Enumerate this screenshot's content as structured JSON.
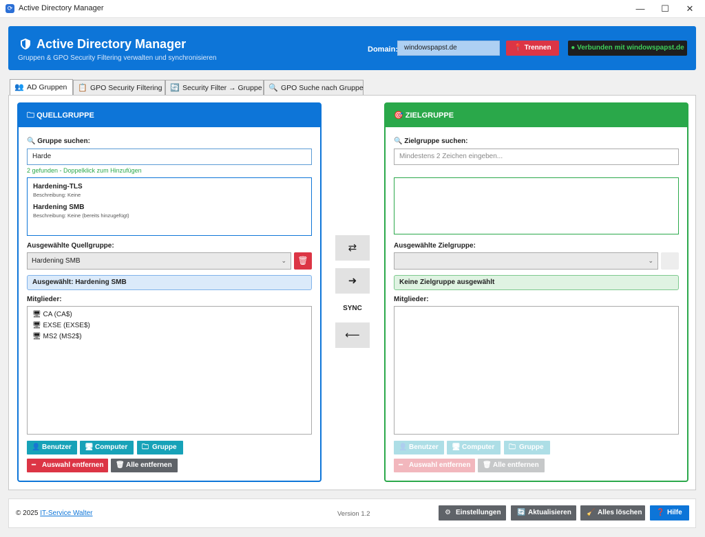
{
  "window": {
    "title": "Active Directory Manager",
    "minimize": "—",
    "maximize": "☐",
    "close": "✕"
  },
  "header": {
    "title": "Active Directory Manager",
    "subtitle": "Gruppen & GPO Security Filtering verwalten und synchronisieren",
    "domain_label": "Domain:",
    "domain_value": "windowspapst.de",
    "disconnect_label": "Trennen",
    "status_text": "● Verbunden mit windowspapst.de"
  },
  "tabs": [
    {
      "label": "AD Gruppen",
      "icon": "👥",
      "active": true
    },
    {
      "label": "GPO Security Filtering",
      "icon": "📋"
    },
    {
      "label": "Security Filter → Gruppe",
      "icon": "🔄"
    },
    {
      "label": "GPO Suche nach Gruppe",
      "icon": "🔍"
    }
  ],
  "source": {
    "title": "QUELLGRUPPE",
    "search_label": "Gruppe suchen:",
    "search_value": "Harde",
    "found_text": "2 gefunden - Doppelklick zum Hinzufügen",
    "results": [
      {
        "name": "Hardening-TLS",
        "desc": "Beschreibung: Keine"
      },
      {
        "name": "Hardening SMB",
        "desc": "Beschreibung: Keine (bereits hinzugefügt)"
      }
    ],
    "selected_label": "Ausgewählte Quellgruppe:",
    "selected_value": "Hardening SMB",
    "selected_info": "Ausgewählt: Hardening SMB",
    "members_label": "Mitglieder:",
    "members": [
      "CA (CA$)",
      "EXSE (EXSE$)",
      "MS2 (MS2$)"
    ],
    "btn_user": "Benutzer",
    "btn_computer": "Computer",
    "btn_group": "Gruppe",
    "btn_remove_sel": "Auswahl entfernen",
    "btn_remove_all": "Alle entfernen"
  },
  "middle": {
    "sync_label": "SYNC",
    "swap_icon": "⇄",
    "right_arrow": "➜",
    "left_arrow": "⟵"
  },
  "target": {
    "title": "ZIELGRUPPE",
    "search_label": "Zielgruppe suchen:",
    "search_placeholder": "Mindestens 2 Zeichen eingeben...",
    "selected_label": "Ausgewählte Zielgruppe:",
    "selected_info": "Keine Zielgruppe ausgewählt",
    "members_label": "Mitglieder:",
    "btn_user": "Benutzer",
    "btn_computer": "Computer",
    "btn_group": "Gruppe",
    "btn_remove_sel": "Auswahl entfernen",
    "btn_remove_all": "Alle entfernen"
  },
  "footer": {
    "copyright": "© 2025",
    "company_link": "IT-Service Walter",
    "version": "Version 1.2",
    "btn_settings": "Einstellungen",
    "btn_refresh": "Aktualisieren",
    "btn_clear": "Alles löschen",
    "btn_help": "Hilfe"
  },
  "colors": {
    "primary": "#0d75d8",
    "success": "#2aa84a",
    "danger": "#dc3545",
    "info": "#17a2b8",
    "secondary": "#5f6368"
  }
}
